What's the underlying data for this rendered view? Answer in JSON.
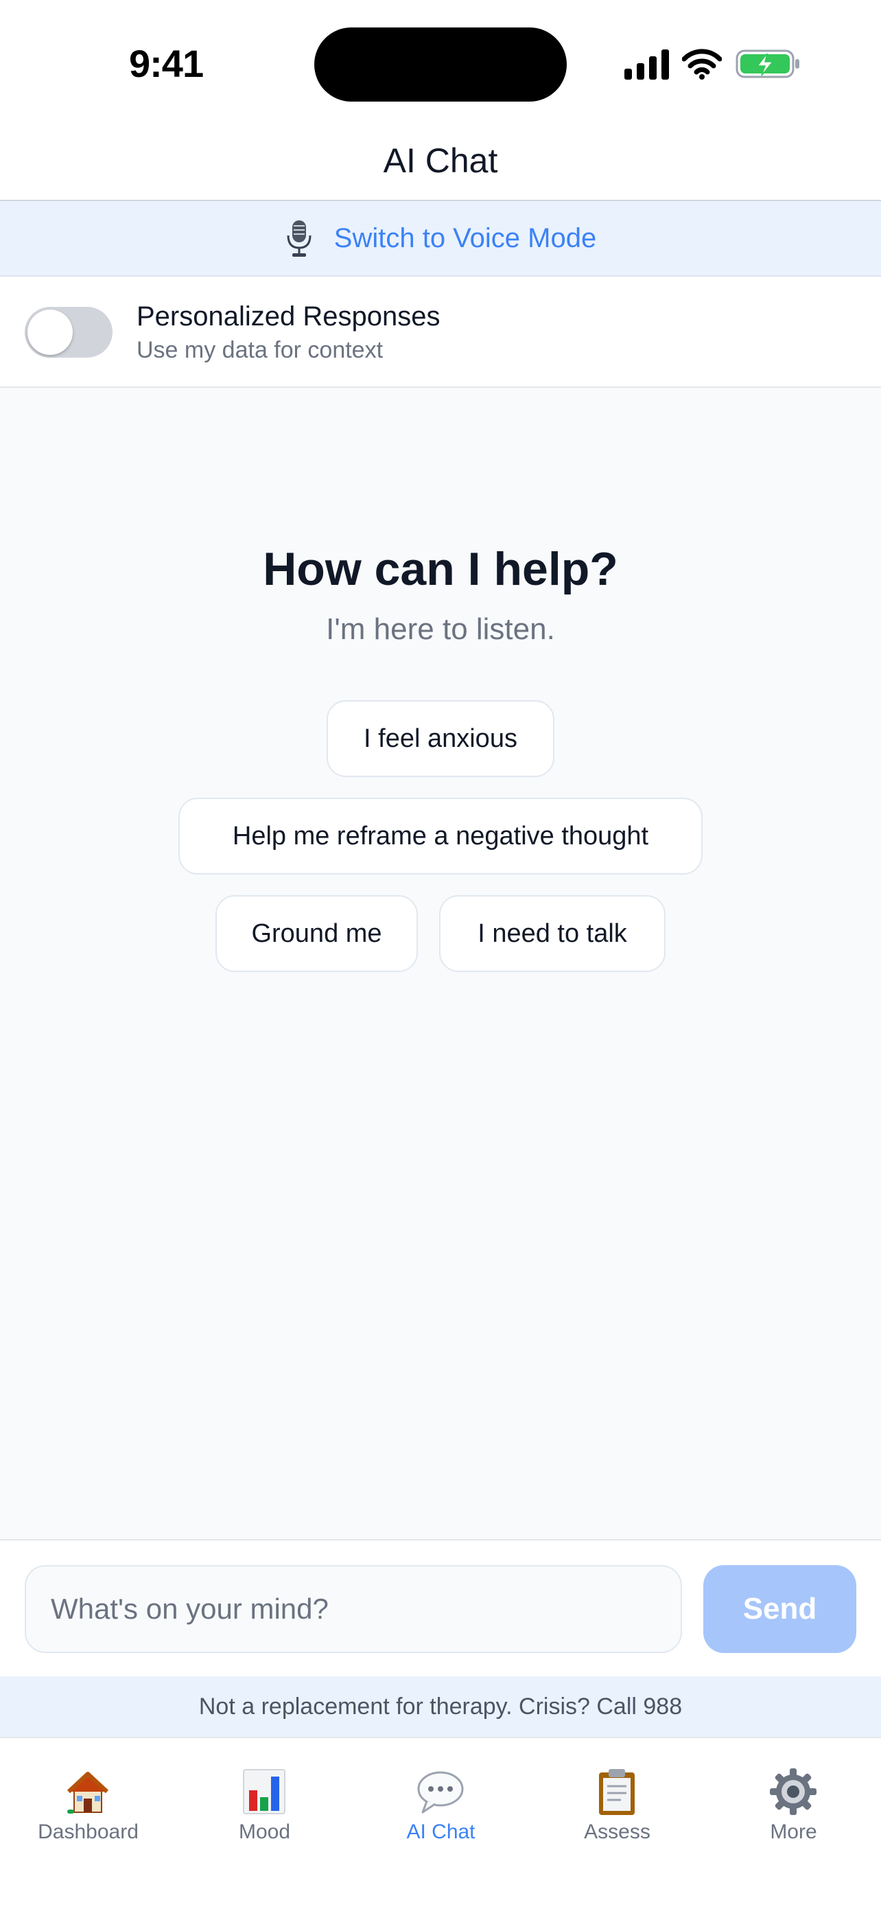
{
  "status_bar": {
    "time": "9:41",
    "icons": [
      "signal-icon",
      "wifi-icon",
      "battery-charging-icon"
    ]
  },
  "header": {
    "title": "AI Chat"
  },
  "voice_banner": {
    "icon": "microphone-icon",
    "label": "Switch to Voice Mode"
  },
  "personalization": {
    "title": "Personalized Responses",
    "subtitle": "Use my data for context",
    "enabled": false
  },
  "empty_state": {
    "title": "How can I help?",
    "subtitle": "I'm here to listen."
  },
  "suggestions": [
    {
      "label": "I feel anxious"
    },
    {
      "label": "Help me reframe a negative thought"
    },
    {
      "label": "Ground me"
    },
    {
      "label": "I need to talk"
    }
  ],
  "composer": {
    "placeholder": "What's on your mind?",
    "value": "",
    "send_label": "Send"
  },
  "disclaimer": "Not a replacement for therapy. Crisis? Call 988",
  "tabs": [
    {
      "label": "Dashboard",
      "icon": "house-icon",
      "active": false
    },
    {
      "label": "Mood",
      "icon": "bar-chart-icon",
      "active": false
    },
    {
      "label": "AI Chat",
      "icon": "speech-bubble-icon",
      "active": true
    },
    {
      "label": "Assess",
      "icon": "clipboard-icon",
      "active": false
    },
    {
      "label": "More",
      "icon": "gear-icon",
      "active": false
    }
  ],
  "colors": {
    "accent": "#3b82f6",
    "accent_disabled": "#a6c5fb",
    "banner_bg": "#eaf2fe",
    "page_bg": "#f8fafc",
    "battery_green": "#34c759"
  }
}
